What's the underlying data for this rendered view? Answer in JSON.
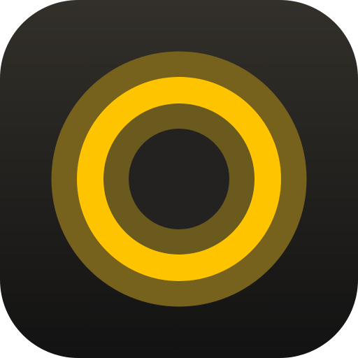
{
  "icon": {
    "name": "concentric-rings-app-icon",
    "background_top": "#33302a",
    "background_bottom": "#121212",
    "outer_ring_color": "#76621d",
    "inner_ring_color": "#ffc400",
    "mid_ring_color": "#6b5a1e",
    "center_color": "#242220"
  }
}
